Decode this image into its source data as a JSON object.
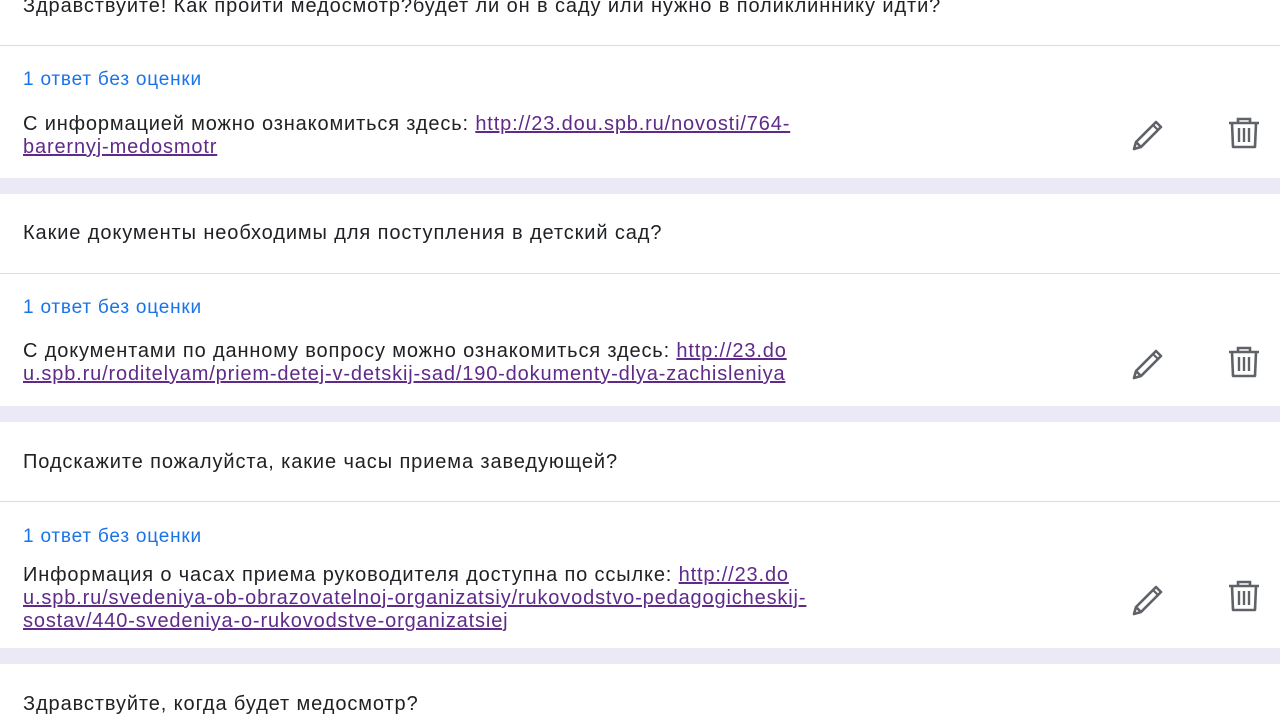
{
  "items": [
    {
      "question": "Здравствуйте! Как пройти медосмотр?будет ли он в саду или нужно в поликлиннику идти?",
      "status": "1 ответ без оценки",
      "answer_text": "С информацией можно ознакомиться здесь: ",
      "answer_link_line1": "http://23.dou.spb.ru/novosti/764-",
      "answer_link_line2": "barernyj-medosmotr",
      "answer_link_line3": "",
      "edit_icon": "pencil-icon",
      "delete_icon": "trash-icon"
    },
    {
      "question": "Какие документы необходимы для поступления в детский сад?",
      "status": "1 ответ без оценки",
      "answer_text": "С документами по данному вопросу можно ознакомиться здесь: ",
      "answer_link_line1": "http://23.do",
      "answer_link_line2": "u.spb.ru/roditelyam/priem-detej-v-detskij-sad/190-dokumenty-dlya-zachisleniya",
      "answer_link_line3": "",
      "edit_icon": "pencil-icon",
      "delete_icon": "trash-icon"
    },
    {
      "question": "Подскажите пожалуйста, какие часы приема заведующей?",
      "status": "1 ответ без оценки",
      "answer_text": "Информация о часах приема руководителя доступна по ссылке: ",
      "answer_link_line1": "http://23.do",
      "answer_link_line2": "u.spb.ru/svedeniya-ob-obrazovatelnoj-organizatsiy/rukovodstvo-pedagogicheskij-",
      "answer_link_line3": "sostav/440-svedeniya-o-rukovodstve-organizatsiej",
      "edit_icon": "pencil-icon",
      "delete_icon": "trash-icon"
    },
    {
      "question": "Здравствуйте, когда будет медосмотр?"
    }
  ],
  "colors": {
    "separator": "#ebe9f5",
    "status": "#1a73e8",
    "link": "#5f2a8a",
    "text": "#202124",
    "icon": "#5f6368"
  }
}
